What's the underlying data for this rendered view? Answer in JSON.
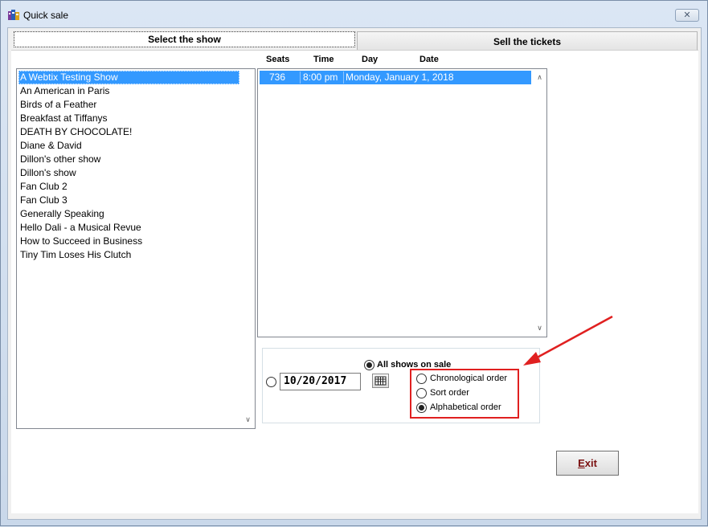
{
  "window": {
    "title": "Quick sale",
    "close_label": "✕"
  },
  "tabs": [
    {
      "label": "Select the show",
      "active": true
    },
    {
      "label": "Sell the tickets",
      "active": false
    }
  ],
  "shows": {
    "selected": "A Webtix Testing Show",
    "items": [
      "A Webtix Testing Show",
      "An American in Paris",
      "Birds of a Feather",
      "Breakfast at Tiffanys",
      "DEATH BY CHOCOLATE!",
      "Diane & David",
      "Dillon's other show",
      "Dillon's show",
      "Fan Club 2",
      "Fan Club 3",
      "Generally Speaking",
      "Hello Dali - a Musical Revue",
      "How to Succeed in Business",
      "Tiny Tim Loses His Clutch"
    ]
  },
  "performances": {
    "columns": [
      "Seats",
      "Time",
      "Day",
      "Date"
    ],
    "rows": [
      {
        "seats": "736",
        "time": "8:00 pm",
        "day_date": "Monday, January 1, 2018",
        "selected": true
      }
    ]
  },
  "filter": {
    "all_shows_label": "All shows on sale",
    "all_shows_checked": true,
    "date_checked": false,
    "date_value": "10/20/2017",
    "order_options": [
      {
        "label": "Chronological order",
        "checked": false
      },
      {
        "label": "Sort order",
        "checked": false
      },
      {
        "label": "Alphabetical order",
        "checked": true
      }
    ]
  },
  "buttons": {
    "exit_prefix": "E",
    "exit_rest": "xit"
  },
  "colors": {
    "selection": "#3399ff",
    "annotation": "#e02020"
  }
}
